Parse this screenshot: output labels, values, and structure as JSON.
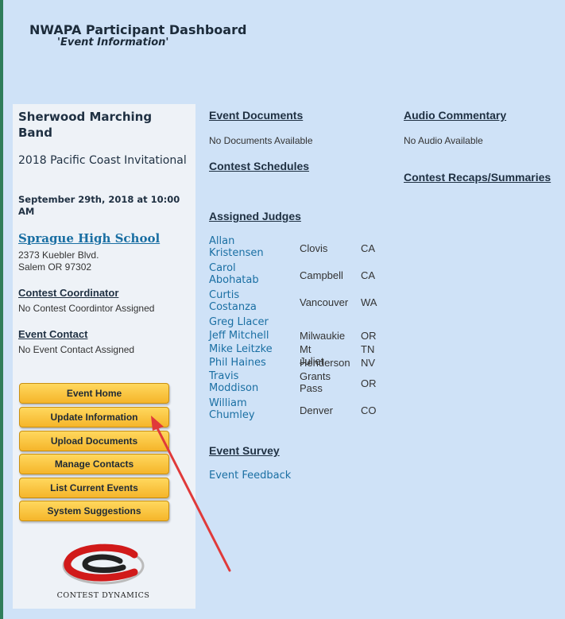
{
  "header": {
    "title": "NWAPA Participant Dashboard",
    "subtitle": "'Event Information'"
  },
  "sidebar": {
    "band": "Sherwood Marching Band",
    "event": "2018 Pacific Coast Invitational",
    "date": "September 29th, 2018 at 10:00 AM",
    "venue": "Sprague High School",
    "address_line1": "2373 Kuebler Blvd.",
    "address_line2": "Salem OR 97302",
    "coordinator_label": "Contest Coordinator",
    "coordinator_value": "No Contest Coordintor Assigned",
    "contact_label": "Event Contact",
    "contact_value": "No Event Contact Assigned",
    "buttons": [
      "Event Home",
      "Update Information",
      "Upload Documents",
      "Manage Contacts",
      "List Current Events",
      "System Suggestions"
    ],
    "logo_text": "CONTEST DYNAMICS"
  },
  "main": {
    "event_documents": "Event Documents",
    "no_documents": "No Documents Available",
    "contest_schedules": "Contest Schedules",
    "assigned_judges": "Assigned Judges",
    "judges": [
      {
        "name": "Allan Kristensen",
        "city": "Clovis",
        "state": "CA"
      },
      {
        "name": "Carol Abohatab",
        "city": "Campbell",
        "state": "CA"
      },
      {
        "name": "Curtis Costanza",
        "city": "Vancouver",
        "state": "WA"
      },
      {
        "name": "Greg Llacer",
        "city": "",
        "state": ""
      },
      {
        "name": "Jeff Mitchell",
        "city": "Milwaukie",
        "state": "OR"
      },
      {
        "name": "Mike Leitzke",
        "city": "Mt Juliet",
        "state": "TN"
      },
      {
        "name": "Phil Haines",
        "city": "Henderson",
        "state": "NV"
      },
      {
        "name": "Travis Moddison",
        "city": "Grants Pass",
        "state": "OR"
      },
      {
        "name": "William Chumley",
        "city": "Denver",
        "state": "CO"
      }
    ],
    "event_survey": "Event Survey",
    "event_feedback": "Event Feedback",
    "audio_commentary": "Audio Commentary",
    "no_audio": "No Audio Available",
    "contest_recaps": "Contest Recaps/Summaries"
  },
  "colors": {
    "background": "#cfe2f7",
    "sidebar": "#eef2f7",
    "button": "#f5b52a",
    "link": "#1a6fa3",
    "annotation_arrow": "#e03a3a"
  }
}
